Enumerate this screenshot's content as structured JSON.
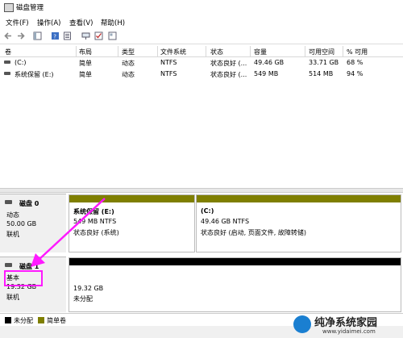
{
  "window": {
    "title": "磁盘管理"
  },
  "menu": [
    "文件(F)",
    "操作(A)",
    "查看(V)",
    "帮助(H)"
  ],
  "volume_table": {
    "columns": [
      "卷",
      "布局",
      "类型",
      "文件系统",
      "状态",
      "容量",
      "可用空间",
      "% 可用"
    ],
    "rows": [
      [
        "(C:)",
        "简单",
        "动态",
        "NTFS",
        "状态良好 (...",
        "49.46 GB",
        "33.71 GB",
        "68 %"
      ],
      [
        "系统保留 (E:)",
        "简单",
        "动态",
        "NTFS",
        "状态良好 (...",
        "549 MB",
        "514 MB",
        "94 %"
      ]
    ]
  },
  "disks": [
    {
      "name": "磁盘 0",
      "type": "动态",
      "size": "50.00 GB",
      "status": "联机",
      "partitions": [
        {
          "title": "系统保留  (E:)",
          "line1": "549 MB NTFS",
          "line2": "状态良好 (系统)"
        },
        {
          "title": "(C:)",
          "line1": "49.46 GB NTFS",
          "line2": "状态良好 (启动, 页面文件, 故障转储)"
        }
      ]
    },
    {
      "name": "磁盘 1",
      "type": "基本",
      "size": "19.32 GB",
      "status": "联机",
      "partitions": [
        {
          "line1": "19.32 GB",
          "line2": "未分配"
        }
      ]
    }
  ],
  "legend": [
    "未分配",
    "简单卷"
  ],
  "colors": {
    "unallocated": "#000000",
    "simple": "#7f7f00",
    "annotation": "#ff19ff"
  },
  "watermark": {
    "text": "纯净系统家园",
    "url": "www.yidaimei.com"
  }
}
